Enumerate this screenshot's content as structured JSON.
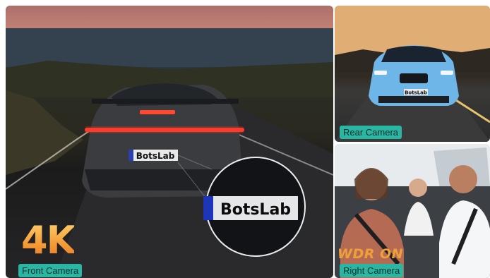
{
  "front_panel": {
    "badge": "4K",
    "caption": "Front Camera",
    "plate_text": "BotsLab",
    "zoom_plate_text": "BotsLab"
  },
  "rear_panel": {
    "caption": "Rear Camera",
    "plate_text": "BotsLab"
  },
  "right_panel": {
    "badge": "WDR ON",
    "caption": "Right Camera"
  },
  "colors": {
    "caption_bg": "#29b7a3",
    "badge_orange": "#f5a541",
    "rear_car_blue": "#6fb6e8"
  }
}
